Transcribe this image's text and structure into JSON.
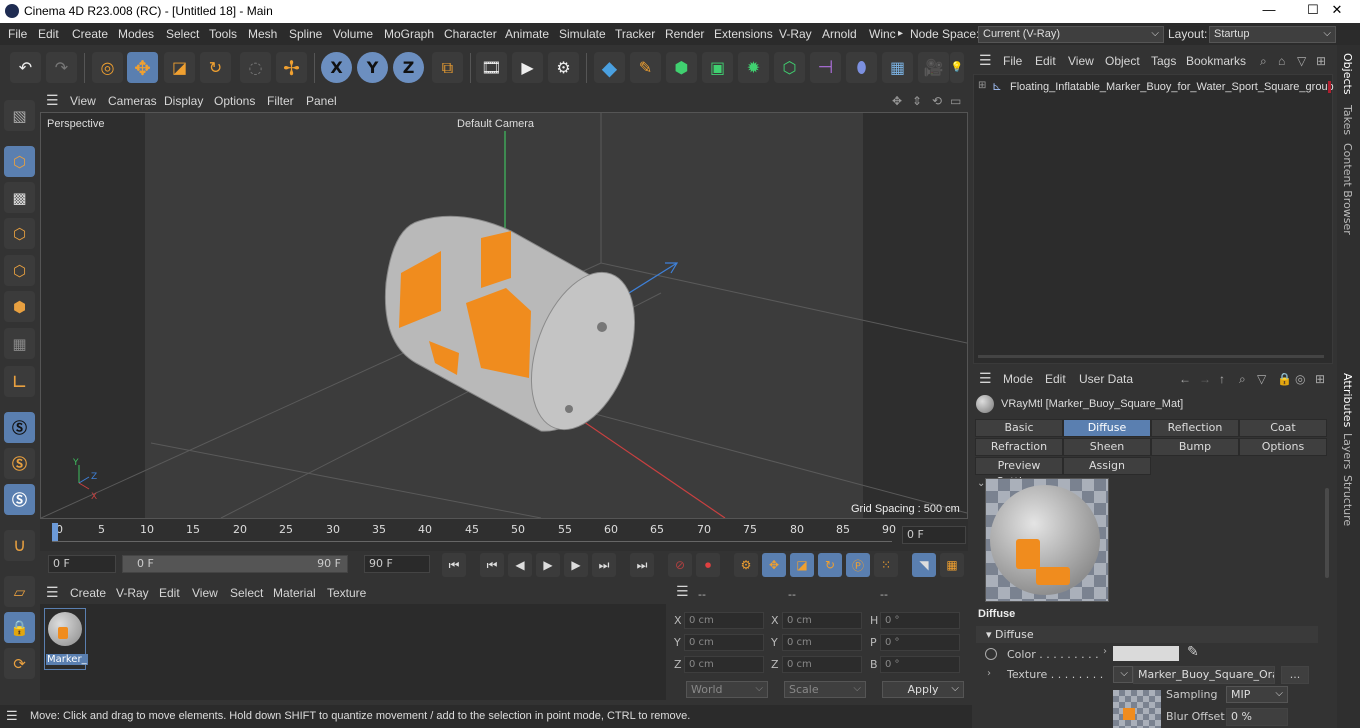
{
  "window": {
    "title": "Cinema 4D R23.008 (RC) - [Untitled 18] - Main",
    "minimize": "—",
    "maximize": "☐",
    "close": "✕"
  },
  "menubar": {
    "items": [
      "File",
      "Edit",
      "Create",
      "Modes",
      "Select",
      "Tools",
      "Mesh",
      "Spline",
      "Volume",
      "MoGraph",
      "Character",
      "Animate",
      "Simulate",
      "Tracker",
      "Render",
      "Extensions",
      "V-Ray",
      "Arnold",
      "Winc"
    ],
    "overflow_arrow": "▸",
    "node_space_label": "Node Space:",
    "node_space_value": "Current (V-Ray)",
    "layout_label": "Layout:",
    "layout_value": "Startup"
  },
  "toolbar": {
    "axis_x": "X",
    "axis_y": "Y",
    "axis_z": "Z"
  },
  "viewport": {
    "menu": [
      "View",
      "Cameras",
      "Display",
      "Options",
      "Filter",
      "Panel"
    ],
    "label": "Perspective",
    "camera": "Default Camera",
    "grid_spacing": "Grid Spacing : 500 cm",
    "axis_y": "Y",
    "axis_z": "Z",
    "axis_x": "X"
  },
  "timeline": {
    "ticks": [
      "0",
      "5",
      "10",
      "15",
      "20",
      "25",
      "30",
      "35",
      "40",
      "45",
      "50",
      "55",
      "60",
      "65",
      "70",
      "75",
      "80",
      "85",
      "90"
    ],
    "current_frame": "0 F"
  },
  "transport": {
    "start_field": "0 F",
    "range_start": "0 F",
    "range_end": "90 F",
    "end_field": "90 F"
  },
  "material_manager": {
    "menu": [
      "Create",
      "V-Ray",
      "Edit",
      "View",
      "Select",
      "Material",
      "Texture"
    ],
    "material_label": "Marker_"
  },
  "coordinates": {
    "headers": [
      "--",
      "--",
      "--"
    ],
    "rows": [
      {
        "a": "X",
        "av": "0 cm",
        "b": "X",
        "bv": "0 cm",
        "c": "H",
        "cv": "0 °"
      },
      {
        "a": "Y",
        "av": "0 cm",
        "b": "Y",
        "bv": "0 cm",
        "c": "P",
        "cv": "0 °"
      },
      {
        "a": "Z",
        "av": "0 cm",
        "b": "Z",
        "bv": "0 cm",
        "c": "B",
        "cv": "0 °"
      }
    ],
    "world": "World",
    "scale": "Scale",
    "apply": "Apply"
  },
  "status": {
    "text": "Move: Click and drag to move elements. Hold down SHIFT to quantize movement / add to the selection in point mode, CTRL to remove."
  },
  "objects_panel": {
    "menu": [
      "File",
      "Edit",
      "View",
      "Object",
      "Tags",
      "Bookmarks"
    ],
    "item": "Floating_Inflatable_Marker_Buoy_for_Water_Sport_Square_group"
  },
  "side_tabs": [
    "Objects",
    "Takes",
    "Content Browser",
    "Attributes",
    "Layers",
    "Structure"
  ],
  "attributes": {
    "menu": [
      "Mode",
      "Edit",
      "User Data"
    ],
    "material_title": "VRayMtl [Marker_Buoy_Square_Mat]",
    "tabs_row1": [
      "Basic",
      "Diffuse",
      "Reflection",
      "Coat"
    ],
    "tabs_row2": [
      "Refraction",
      "Sheen",
      "Bump",
      "Options"
    ],
    "tabs_row3": [
      "Preview Settings",
      "Assign"
    ],
    "active_tab": "Diffuse",
    "section": "Diffuse",
    "subsection": "Diffuse",
    "color_label": "Color . . . . . . . . .",
    "texture_label": "Texture . . . . . . . .",
    "texture_value": "Marker_Buoy_Square_Orang",
    "texture_more": "...",
    "sampling_label": "Sampling",
    "sampling_value": "MIP",
    "blur_label": "Blur Offset",
    "blur_value": "0 %"
  },
  "colors": {
    "accent": "#5a7fb0",
    "orange": "#f08c1e",
    "buoy_gray": "#b9b9b9"
  }
}
